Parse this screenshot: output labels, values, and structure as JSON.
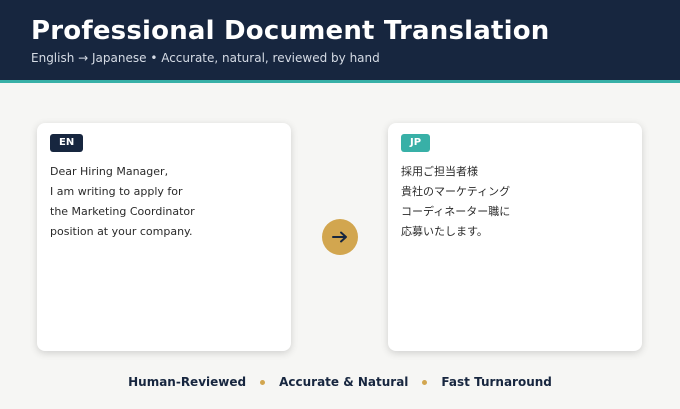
{
  "header": {
    "title": "Professional Document Translation",
    "subtitle": "English → Japanese  •  Accurate, natural, reviewed by hand"
  },
  "source_card": {
    "badge": "EN",
    "lines": [
      "Dear Hiring Manager,",
      "I am writing to apply for",
      "the Marketing Coordinator",
      "position at your company."
    ]
  },
  "arrow": {
    "icon": "arrow-right-icon"
  },
  "target_card": {
    "badge": "JP",
    "lines": [
      "採用ご担当者様",
      "貴社のマーケティング",
      "コーディネーター職に",
      "応募いたします。"
    ]
  },
  "features": {
    "items": [
      "Human-Reviewed",
      "Accurate & Natural",
      "Fast Turnaround"
    ]
  },
  "colors": {
    "navy": "#17263f",
    "teal": "#38b0a7",
    "gold": "#d2a64f",
    "background": "#f6f6f4"
  }
}
